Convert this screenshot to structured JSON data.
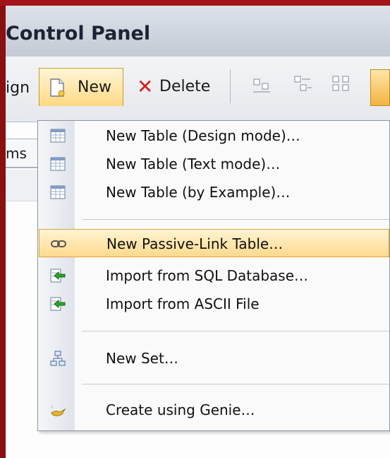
{
  "window": {
    "title": "Control Panel"
  },
  "toolbar": {
    "design_fragment": "ign",
    "new_label": "New",
    "delete_label": "Delete"
  },
  "tabs": {
    "fragment": "ms"
  },
  "menu": {
    "items": [
      {
        "label": "New Table (Design mode)…",
        "icon": "table-icon"
      },
      {
        "label": "New Table (Text mode)…",
        "icon": "table-icon"
      },
      {
        "label": "New Table (by Example)…",
        "icon": "table-icon"
      },
      {
        "label": "New Passive-Link Table…",
        "icon": "chain-link-icon",
        "highlighted": true
      },
      {
        "label": "Import from SQL Database…",
        "icon": "import-arrow-icon"
      },
      {
        "label": "Import from ASCII File",
        "icon": "import-arrow-icon"
      },
      {
        "label": "New Set…",
        "icon": "hierarchy-icon"
      },
      {
        "label": "Create using Genie…",
        "icon": "genie-lamp-icon"
      }
    ]
  },
  "colors": {
    "accent_highlight": "#ffd98d",
    "frame_red": "#8a0f10"
  }
}
